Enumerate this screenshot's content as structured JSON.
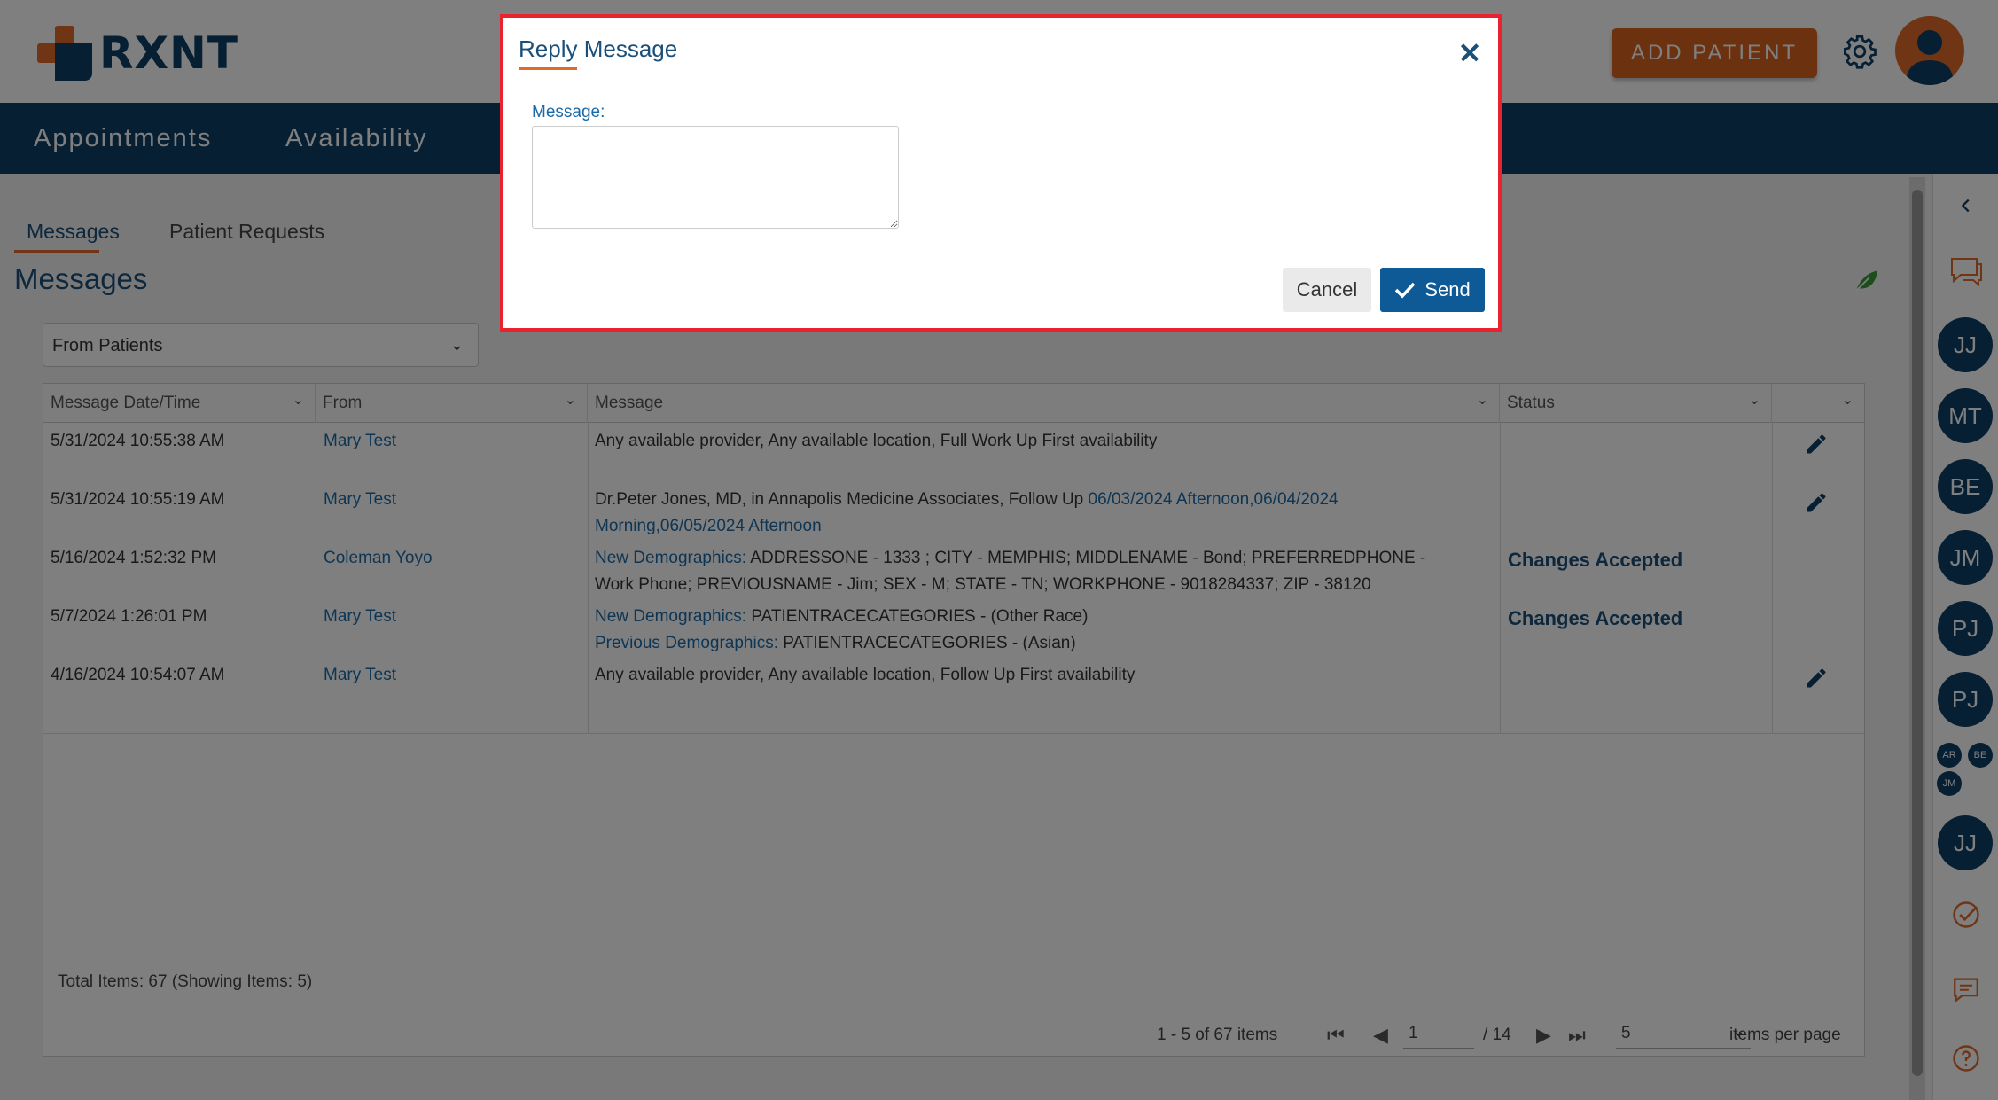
{
  "header": {
    "logo_text": "RXNT",
    "add_patient_label": "ADD PATIENT"
  },
  "nav": {
    "items": [
      {
        "label": "Appointments"
      },
      {
        "label": "Availability"
      }
    ]
  },
  "tabs": [
    {
      "label": "Messages",
      "active": true
    },
    {
      "label": "Patient Requests",
      "active": false
    }
  ],
  "page_title": "Messages",
  "filter": {
    "selected": "From Patients"
  },
  "grid": {
    "columns": [
      "Message Date/Time",
      "From",
      "Message",
      "Status"
    ],
    "rows": [
      {
        "datetime": "5/31/2024 10:55:38 AM",
        "from": "Mary Test",
        "message": "Any available provider, Any available location, Full Work Up First availability",
        "status": "",
        "editable": true
      },
      {
        "datetime": "5/31/2024 10:55:19 AM",
        "from": "Mary Test",
        "message": "Dr.Peter Jones, MD, in Annapolis Medicine Associates, Follow Up ",
        "message_link": "06/03/2024 Afternoon,06/04/2024",
        "message_link2": "Morning,06/05/2024 Afternoon",
        "status": "",
        "editable": true
      },
      {
        "datetime": "5/16/2024 1:52:32 PM",
        "from": "Coleman Yoyo",
        "message_prefix": "New Demographics:",
        "message": " ADDRESSONE - 1333 ; CITY - MEMPHIS; MIDDLENAME - Bond; PREFERREDPHONE -",
        "message_line2": "Work Phone; PREVIOUSNAME - Jim; SEX - M; STATE - TN; WORKPHONE - 9018284337; ZIP - 38120",
        "status": "Changes Accepted",
        "editable": false
      },
      {
        "datetime": "5/7/2024 1:26:01 PM",
        "from": "Mary Test",
        "message_prefix": "New Demographics:",
        "message": " PATIENTRACECATEGORIES - (Other Race)",
        "message_prefix2": "Previous Demographics:",
        "message_line2": " PATIENTRACECATEGORIES - (Asian)",
        "status": "Changes Accepted",
        "editable": false
      },
      {
        "datetime": "4/16/2024 10:54:07 AM",
        "from": "Mary Test",
        "message": "Any available provider, Any available location, Follow Up First availability",
        "status": "",
        "editable": true
      }
    ],
    "total_text": "Total Items: 67 (Showing Items: 5)",
    "pager": {
      "range_text": "1 - 5 of 67 items",
      "current_page": "1",
      "total_pages_text": "/ 14",
      "page_size": "5",
      "items_per_page_label": "items per page"
    }
  },
  "rail": {
    "bubbles": [
      "JJ",
      "MT",
      "BE",
      "JM",
      "PJ",
      "PJ",
      "JJ"
    ],
    "mini_bubbles": [
      "AR",
      "BE",
      "JM"
    ]
  },
  "dialog": {
    "title": "Reply Message",
    "message_label": "Message:",
    "message_value": "",
    "cancel_label": "Cancel",
    "send_label": "Send"
  },
  "colors": {
    "brand_navy": "#0d3f66",
    "brand_orange": "#e06a28",
    "link_blue": "#1a6aa8",
    "dialog_highlight": "#e8232f",
    "send_blue": "#0e5a96"
  }
}
